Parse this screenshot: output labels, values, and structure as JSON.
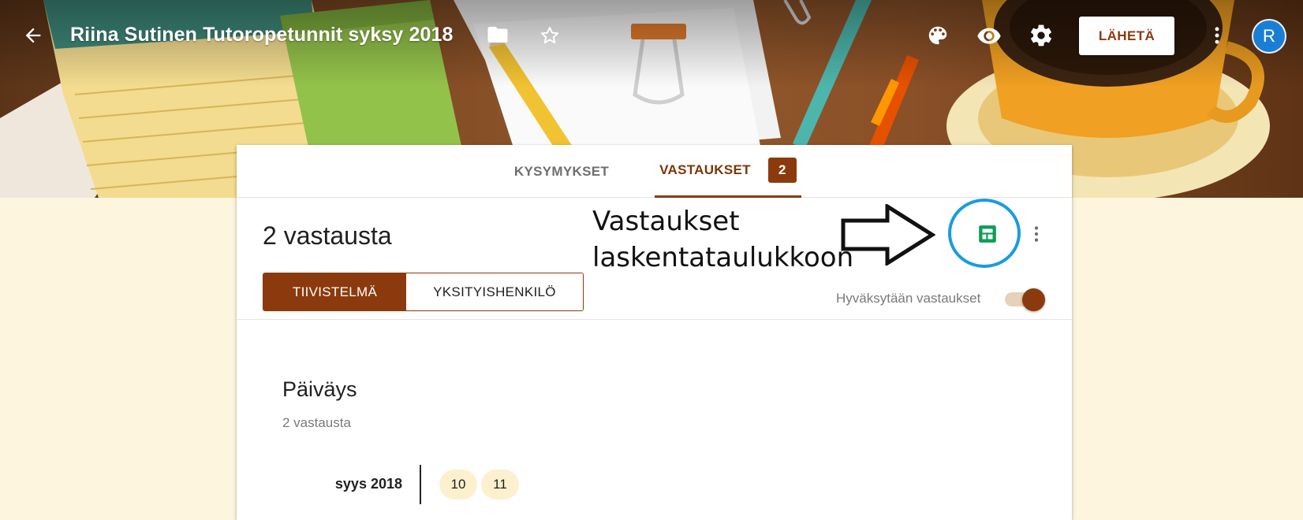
{
  "header": {
    "title": "Riina Sutinen Tutoropetunnit syksy 2018",
    "send_label": "LÄHETÄ",
    "avatar_initial": "R",
    "icons": [
      "back-arrow-icon",
      "folder-icon",
      "star-icon",
      "palette-icon",
      "eye-icon",
      "gear-icon",
      "more-vert-icon"
    ]
  },
  "tabs": {
    "questions_label": "KYSYMYKSET",
    "responses_label": "VASTAUKSET",
    "responses_badge": "2",
    "active": "responses"
  },
  "summary": {
    "count_label": "2 vastausta",
    "view_toggle": {
      "summary_label": "TIIVISTELMÄ",
      "individual_label": "YKSITYISHENKILÖ",
      "selected": "summary"
    },
    "accepting_label": "Hyväksytään vastaukset",
    "accepting_on": true
  },
  "question": {
    "title": "Päiväys",
    "count_label": "2 vastausta",
    "month_label": "syys 2018",
    "days": [
      "10",
      "11"
    ]
  },
  "annotation": {
    "line1": "Vastaukset",
    "line2": "laskentataulukkoon",
    "circle_color": "#1a9be0"
  },
  "colors": {
    "accent": "#8b3a0d",
    "background": "#fdf5de",
    "sheets_green": "#0f9d58",
    "avatar_blue": "#1a7fd4"
  }
}
